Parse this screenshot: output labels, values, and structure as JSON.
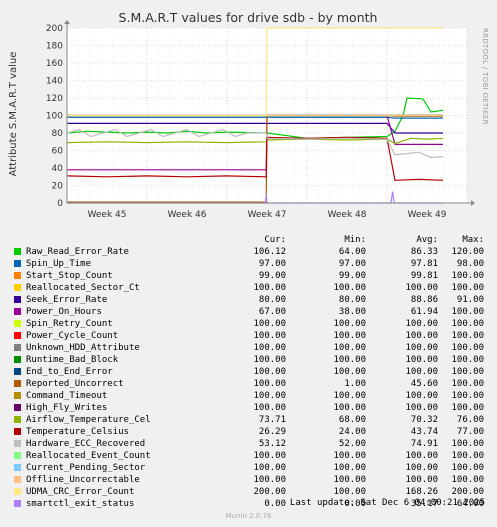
{
  "chart_data": {
    "type": "line",
    "title": "S.M.A.R.T values for drive sdb - by month",
    "ylabel": "Attribute S.M.A.R.T value",
    "side_text": "RRDTOOL / TOBI OETIKER",
    "ylim": [
      0,
      200
    ],
    "yticks": [
      0,
      20,
      40,
      60,
      80,
      100,
      120,
      140,
      160,
      180,
      200
    ],
    "xlim": [
      0,
      5
    ],
    "x_ticks": [
      {
        "label": "Week 45",
        "x": 0.5
      },
      {
        "label": "Week 46",
        "x": 1.5
      },
      {
        "label": "Week 47",
        "x": 2.5
      },
      {
        "label": "Week 48",
        "x": 3.5
      },
      {
        "label": "Week 49",
        "x": 4.5
      }
    ],
    "grid": true,
    "series": [
      {
        "name": "Raw_Read_Error_Rate",
        "color": "#00cc00",
        "cur": "106.12",
        "min": "64.00",
        "avg": "86.33",
        "max": "120.00",
        "points": [
          [
            0.0,
            80
          ],
          [
            0.25,
            82
          ],
          [
            0.5,
            81
          ],
          [
            0.75,
            80
          ],
          [
            1.0,
            81
          ],
          [
            1.25,
            80
          ],
          [
            1.5,
            82
          ],
          [
            1.75,
            80
          ],
          [
            2.0,
            81
          ],
          [
            2.5,
            80
          ],
          [
            3.0,
            74
          ],
          [
            3.5,
            75
          ],
          [
            4.0,
            76
          ],
          [
            4.1,
            82
          ],
          [
            4.2,
            100
          ],
          [
            4.25,
            120
          ],
          [
            4.45,
            119
          ],
          [
            4.55,
            104
          ],
          [
            4.7,
            106
          ]
        ]
      },
      {
        "name": "Spin_Up_Time",
        "color": "#0066b3",
        "cur": "97.00",
        "min": "97.00",
        "avg": "97.81",
        "max": "98.00",
        "points": [
          [
            0.0,
            98
          ],
          [
            2.49,
            98
          ],
          [
            2.5,
            98
          ],
          [
            3.5,
            98
          ],
          [
            4.0,
            98
          ],
          [
            4.1,
            97
          ],
          [
            4.7,
            97
          ]
        ]
      },
      {
        "name": "Start_Stop_Count",
        "color": "#ff8000",
        "cur": "99.00",
        "min": "99.00",
        "avg": "99.81",
        "max": "100.00",
        "points": [
          [
            0.0,
            100
          ],
          [
            2.49,
            100
          ],
          [
            2.5,
            100
          ],
          [
            4.0,
            100
          ],
          [
            4.1,
            99
          ],
          [
            4.7,
            99
          ]
        ]
      },
      {
        "name": "Reallocated_Sector_Ct",
        "color": "#ffcc00",
        "cur": "100.00",
        "min": "100.00",
        "avg": "100.00",
        "max": "100.00",
        "points": [
          [
            0.0,
            100
          ],
          [
            4.7,
            100
          ]
        ]
      },
      {
        "name": "Seek_Error_Rate",
        "color": "#330099",
        "cur": "80.00",
        "min": "80.00",
        "avg": "88.86",
        "max": "91.00",
        "points": [
          [
            0.0,
            91
          ],
          [
            2.49,
            91
          ],
          [
            2.5,
            91
          ],
          [
            4.0,
            91
          ],
          [
            4.1,
            80
          ],
          [
            4.7,
            80
          ]
        ]
      },
      {
        "name": "Power_On_Hours",
        "color": "#990099",
        "cur": "67.00",
        "min": "38.00",
        "avg": "61.94",
        "max": "100.00",
        "points": [
          [
            0.0,
            38
          ],
          [
            2.49,
            38
          ],
          [
            2.5,
            100
          ],
          [
            4.0,
            100
          ],
          [
            4.1,
            67
          ],
          [
            4.7,
            67
          ]
        ]
      },
      {
        "name": "Spin_Retry_Count",
        "color": "#ccff00",
        "cur": "100.00",
        "min": "100.00",
        "avg": "100.00",
        "max": "100.00",
        "points": [
          [
            0.0,
            100
          ],
          [
            4.7,
            100
          ]
        ]
      },
      {
        "name": "Power_Cycle_Count",
        "color": "#ff0000",
        "cur": "100.00",
        "min": "100.00",
        "avg": "100.00",
        "max": "100.00",
        "points": [
          [
            0.0,
            100
          ],
          [
            4.7,
            100
          ]
        ]
      },
      {
        "name": "Unknown_HDD_Attribute",
        "color": "#808080",
        "cur": "100.00",
        "min": "100.00",
        "avg": "100.00",
        "max": "100.00",
        "points": [
          [
            0.0,
            100
          ],
          [
            4.7,
            100
          ]
        ]
      },
      {
        "name": "Runtime_Bad_Block",
        "color": "#008f00",
        "cur": "100.00",
        "min": "100.00",
        "avg": "100.00",
        "max": "100.00",
        "points": [
          [
            0.0,
            100
          ],
          [
            4.7,
            100
          ]
        ]
      },
      {
        "name": "End_to_End_Error",
        "color": "#00487d",
        "cur": "100.00",
        "min": "100.00",
        "avg": "100.00",
        "max": "100.00",
        "points": [
          [
            0.0,
            100
          ],
          [
            4.7,
            100
          ]
        ]
      },
      {
        "name": "Reported_Uncorrect",
        "color": "#b35a00",
        "cur": "100.00",
        "min": "1.00",
        "avg": "45.60",
        "max": "100.00",
        "points": [
          [
            0.0,
            1
          ],
          [
            2.49,
            1
          ],
          [
            2.5,
            100
          ],
          [
            4.7,
            100
          ]
        ]
      },
      {
        "name": "Command_Timeout",
        "color": "#b38f00",
        "cur": "100.00",
        "min": "100.00",
        "avg": "100.00",
        "max": "100.00",
        "points": [
          [
            0.0,
            100
          ],
          [
            4.7,
            100
          ]
        ]
      },
      {
        "name": "High_Fly_Writes",
        "color": "#6b006b",
        "cur": "100.00",
        "min": "100.00",
        "avg": "100.00",
        "max": "100.00",
        "points": [
          [
            0.0,
            100
          ],
          [
            4.7,
            100
          ]
        ]
      },
      {
        "name": "Airflow_Temperature_Cel",
        "color": "#8fb300",
        "cur": "73.71",
        "min": "68.00",
        "avg": "70.32",
        "max": "76.00",
        "points": [
          [
            0.0,
            69
          ],
          [
            0.5,
            70
          ],
          [
            1.0,
            69
          ],
          [
            1.5,
            70
          ],
          [
            2.0,
            69
          ],
          [
            2.49,
            70
          ],
          [
            2.5,
            72
          ],
          [
            3.0,
            73
          ],
          [
            3.5,
            72
          ],
          [
            4.0,
            73
          ],
          [
            4.1,
            68
          ],
          [
            4.3,
            74
          ],
          [
            4.5,
            73
          ],
          [
            4.7,
            74
          ]
        ]
      },
      {
        "name": "Temperature_Celsius",
        "color": "#b30000",
        "cur": "26.29",
        "min": "24.00",
        "avg": "43.74",
        "max": "77.00",
        "points": [
          [
            0.0,
            31
          ],
          [
            0.5,
            30
          ],
          [
            1.0,
            31
          ],
          [
            1.5,
            30
          ],
          [
            2.0,
            31
          ],
          [
            2.49,
            30
          ],
          [
            2.5,
            75
          ],
          [
            3.0,
            74
          ],
          [
            3.5,
            75
          ],
          [
            4.0,
            74
          ],
          [
            4.1,
            26
          ],
          [
            4.4,
            27
          ],
          [
            4.7,
            26
          ]
        ]
      },
      {
        "name": "Hardware_ECC_Recovered",
        "color": "#bebebe",
        "cur": "53.12",
        "min": "52.00",
        "avg": "74.91",
        "max": "100.00",
        "points": [
          [
            0.0,
            80
          ],
          [
            0.15,
            84
          ],
          [
            0.3,
            76
          ],
          [
            0.45,
            80
          ],
          [
            0.6,
            84
          ],
          [
            0.75,
            76
          ],
          [
            0.9,
            80
          ],
          [
            1.05,
            84
          ],
          [
            1.2,
            76
          ],
          [
            1.35,
            80
          ],
          [
            1.5,
            84
          ],
          [
            1.65,
            76
          ],
          [
            1.8,
            80
          ],
          [
            1.95,
            84
          ],
          [
            2.1,
            76
          ],
          [
            2.25,
            80
          ],
          [
            2.49,
            80
          ],
          [
            2.5,
            74
          ],
          [
            3.0,
            73
          ],
          [
            3.5,
            74
          ],
          [
            4.0,
            73
          ],
          [
            4.1,
            55
          ],
          [
            4.4,
            58
          ],
          [
            4.55,
            52
          ],
          [
            4.7,
            53
          ]
        ]
      },
      {
        "name": "Reallocated_Event_Count",
        "color": "#80ff80",
        "cur": "100.00",
        "min": "100.00",
        "avg": "100.00",
        "max": "100.00",
        "points": [
          [
            0.0,
            100
          ],
          [
            4.7,
            100
          ]
        ]
      },
      {
        "name": "Current_Pending_Sector",
        "color": "#80c9ff",
        "cur": "100.00",
        "min": "100.00",
        "avg": "100.00",
        "max": "100.00",
        "points": [
          [
            0.0,
            100
          ],
          [
            4.7,
            100
          ]
        ]
      },
      {
        "name": "Offline_Uncorrectable",
        "color": "#ffc080",
        "cur": "100.00",
        "min": "100.00",
        "avg": "100.00",
        "max": "100.00",
        "points": [
          [
            0.0,
            100
          ],
          [
            4.7,
            100
          ]
        ]
      },
      {
        "name": "UDMA_CRC_Error_Count",
        "color": "#ffe680",
        "cur": "200.00",
        "min": "100.00",
        "avg": "168.26",
        "max": "200.00",
        "points": [
          [
            0.0,
            100
          ],
          [
            2.49,
            100
          ],
          [
            2.5,
            200
          ],
          [
            4.0,
            200
          ],
          [
            4.1,
            200
          ],
          [
            4.7,
            200
          ]
        ]
      },
      {
        "name": "smartctl_exit_status",
        "color": "#aa80ff",
        "cur": "0.00",
        "min": "0.00",
        "avg": "35.17",
        "max": "64.00",
        "points": [
          [
            0.0,
            0
          ],
          [
            2.48,
            0
          ],
          [
            2.49,
            10
          ],
          [
            2.5,
            0
          ],
          [
            4.05,
            0
          ],
          [
            4.07,
            13
          ],
          [
            4.09,
            0
          ],
          [
            4.7,
            0
          ]
        ]
      }
    ]
  },
  "legend_headers": {
    "cur": "Cur:",
    "min": "Min:",
    "avg": "Avg:",
    "max": "Max:"
  },
  "last_update": "Last update: Sat Dec  6 04:00:21 2025",
  "footer": "Munin 2.0.76"
}
